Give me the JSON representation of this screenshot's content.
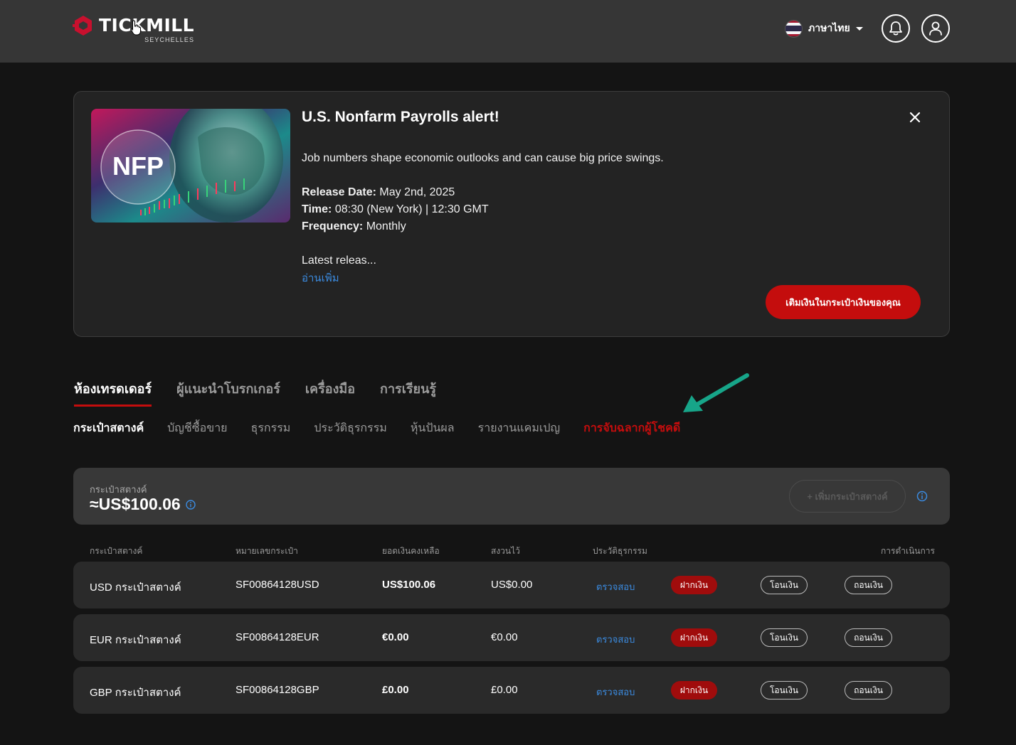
{
  "header": {
    "logo_text": "TICKMILL",
    "logo_sub": "SEYCHELLES",
    "language": "ภาษาไทย"
  },
  "promo": {
    "image_label": "NFP",
    "title": "U.S. Nonfarm Payrolls alert!",
    "description": "Job numbers shape economic outlooks and can cause big price swings.",
    "release_label": "Release Date:",
    "release_value": " May 2nd, 2025",
    "time_label": "Time:",
    "time_value": " 08:30 (New York) | 12:30 GMT",
    "frequency_label": "Frequency:",
    "frequency_value": " Monthly",
    "latest": "Latest releas...",
    "read_more": "อ่านเพิ่ม",
    "cta": "เติมเงินในกระเป๋าเงินของคุณ"
  },
  "main_tabs": [
    "ห้องเทรดเดอร์",
    "ผู้แนะนำโบรกเกอร์",
    "เครื่องมือ",
    "การเรียนรู้"
  ],
  "sub_tabs": [
    "กระเป๋าสตางค์",
    "บัญชีซื้อขาย",
    "ธุรกรรม",
    "ประวัติธุรกรรม",
    "หุ้นปันผล",
    "รายงานแคมเปญ",
    "การจับฉลากผู้โชคดี"
  ],
  "wallet_summary": {
    "label": "กระเป๋าสตางค์",
    "total": "≈US$100.06",
    "add_wallet": "+ เพิ่มกระเป๋าสตางค์"
  },
  "table": {
    "headers": {
      "wallet": "กระเป๋าสตางค์",
      "number": "หมายเลขกระเป๋า",
      "balance": "ยอดเงินคงเหลือ",
      "reserved": "สงวนไว้",
      "history": "ประวัติธุรกรรม",
      "actions": "การดำเนินการ"
    },
    "rows": [
      {
        "wallet": "USD กระเป๋าสตางค์",
        "number": "SF00864128USD",
        "balance": "US$100.06",
        "reserved": "US$0.00",
        "history": "ตรวจสอบ",
        "deposit": "ฝากเงิน",
        "transfer": "โอนเงิน",
        "withdraw": "ถอนเงิน"
      },
      {
        "wallet": "EUR กระเป๋าสตางค์",
        "number": "SF00864128EUR",
        "balance": "€0.00",
        "reserved": "€0.00",
        "history": "ตรวจสอบ",
        "deposit": "ฝากเงิน",
        "transfer": "โอนเงิน",
        "withdraw": "ถอนเงิน"
      },
      {
        "wallet": "GBP กระเป๋าสตางค์",
        "number": "SF00864128GBP",
        "balance": "£0.00",
        "reserved": "£0.00",
        "history": "ตรวจสอบ",
        "deposit": "ฝากเงิน",
        "transfer": "โอนเงิน",
        "withdraw": "ถอนเงิน"
      }
    ]
  },
  "colors": {
    "accent": "#c40d0d",
    "link": "#3b8be0",
    "annotation_arrow": "#17a589"
  },
  "icons": [
    "tickmill-logo-icon",
    "hand-cursor-icon",
    "thailand-flag-icon",
    "chevron-down-icon",
    "bell-icon",
    "user-icon",
    "close-icon",
    "info-icon",
    "annotation-arrow-icon"
  ]
}
